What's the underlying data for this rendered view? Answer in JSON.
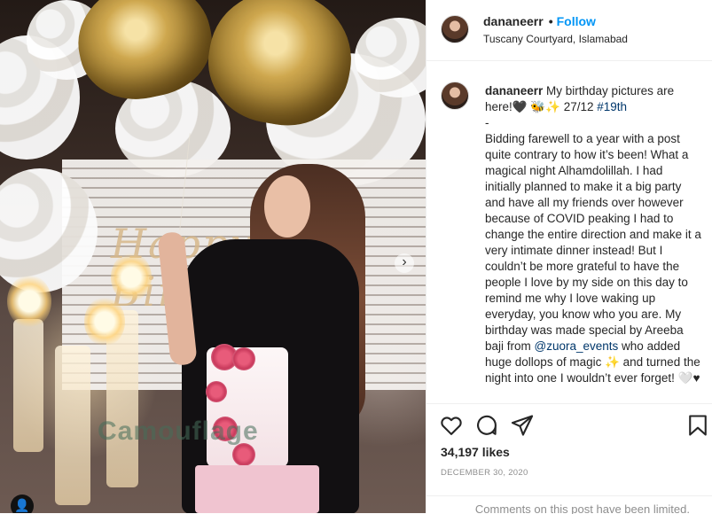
{
  "post": {
    "username": "dananeerr",
    "follow_label": "Follow",
    "separator": "•",
    "location": "Tuscany Courtyard, Islamabad"
  },
  "photo": {
    "watermark": "Camouflage",
    "decor_text": "Happy Birthday"
  },
  "caption": {
    "username": "dananeerr",
    "line1": " My birthday pictures are here!🖤 🐝✨ 27/12 ",
    "hashtag": "#19th",
    "body1": "\n-\nBidding farewell to a year with a post quite contrary to how it’s been! What a magical night Alhamdolillah. I had initially planned to make it a big party and have all my friends over however because of COVID peaking I had to change the entire direction and make it a very intimate dinner instead! But I couldn’t be more grateful to have the people I love by my side on this day to remind me why I love waking up everyday, you know who you are. My birthday was made special by Areeba baji from ",
    "mention": "@zuora_events",
    "body2": " who added huge dollops of magic ✨ and turned the night into one I wouldn’t ever forget! 🤍♥"
  },
  "stats": {
    "likes": "34,197 likes",
    "date": "DECEMBER 30, 2020",
    "comments_note": "Comments on this post have been limited."
  },
  "icons": [
    "heart-icon",
    "comment-icon",
    "share-icon",
    "bookmark-icon",
    "next-arrow-icon",
    "tag-person-icon"
  ]
}
